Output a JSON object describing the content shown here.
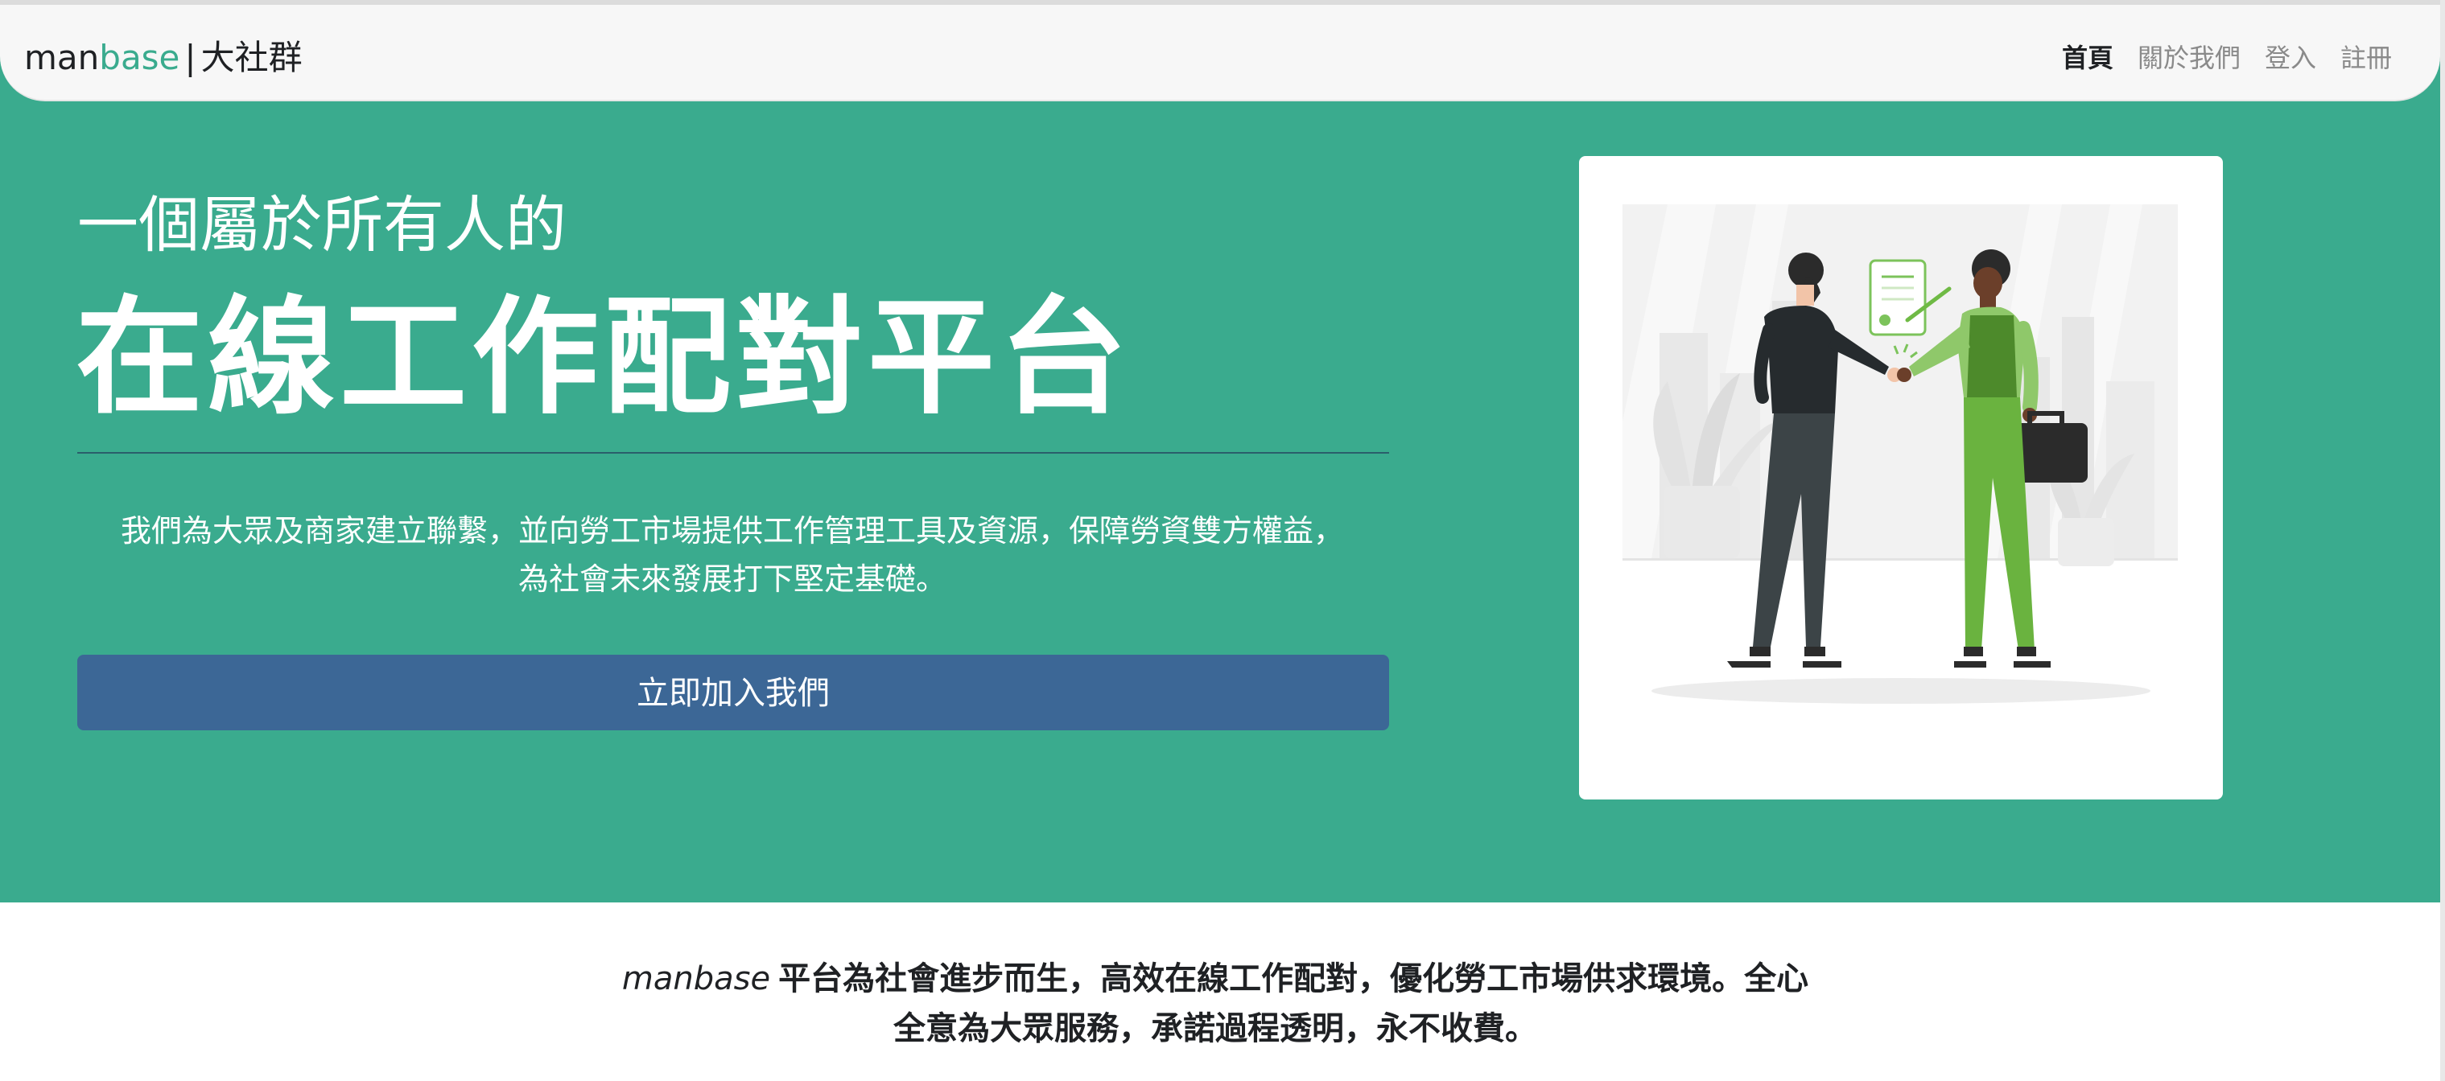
{
  "navbar": {
    "brand_prefix": "man",
    "brand_accent": "base",
    "brand_separator": "|",
    "brand_suffix": "大社群",
    "links": [
      {
        "label": "首頁",
        "active": true
      },
      {
        "label": "關於我們",
        "active": false
      },
      {
        "label": "登入",
        "active": false
      },
      {
        "label": "註冊",
        "active": false
      }
    ]
  },
  "hero": {
    "subtitle": "一個屬於所有人的",
    "title": "在線工作配對平台",
    "description": "我們為大眾及商家建立聯繫，並向勞工市場提供工作管理工具及資源，保障勞資雙方權益，為社會未來發展打下堅定基礎。",
    "cta_label": "立即加入我們",
    "illustration": "handshake-illustration"
  },
  "tagline": {
    "brand": "manbase",
    "text": "平台為社會進步而生，高效在線工作配對，優化勞工市場供求環境。全心全意為大眾服務，承諾過程透明，永不收費。"
  },
  "colors": {
    "primary_green": "#3aab8e",
    "button_blue": "#3c6796",
    "navbar_bg": "#f7f7f7",
    "divider": "#2a5e6b"
  }
}
